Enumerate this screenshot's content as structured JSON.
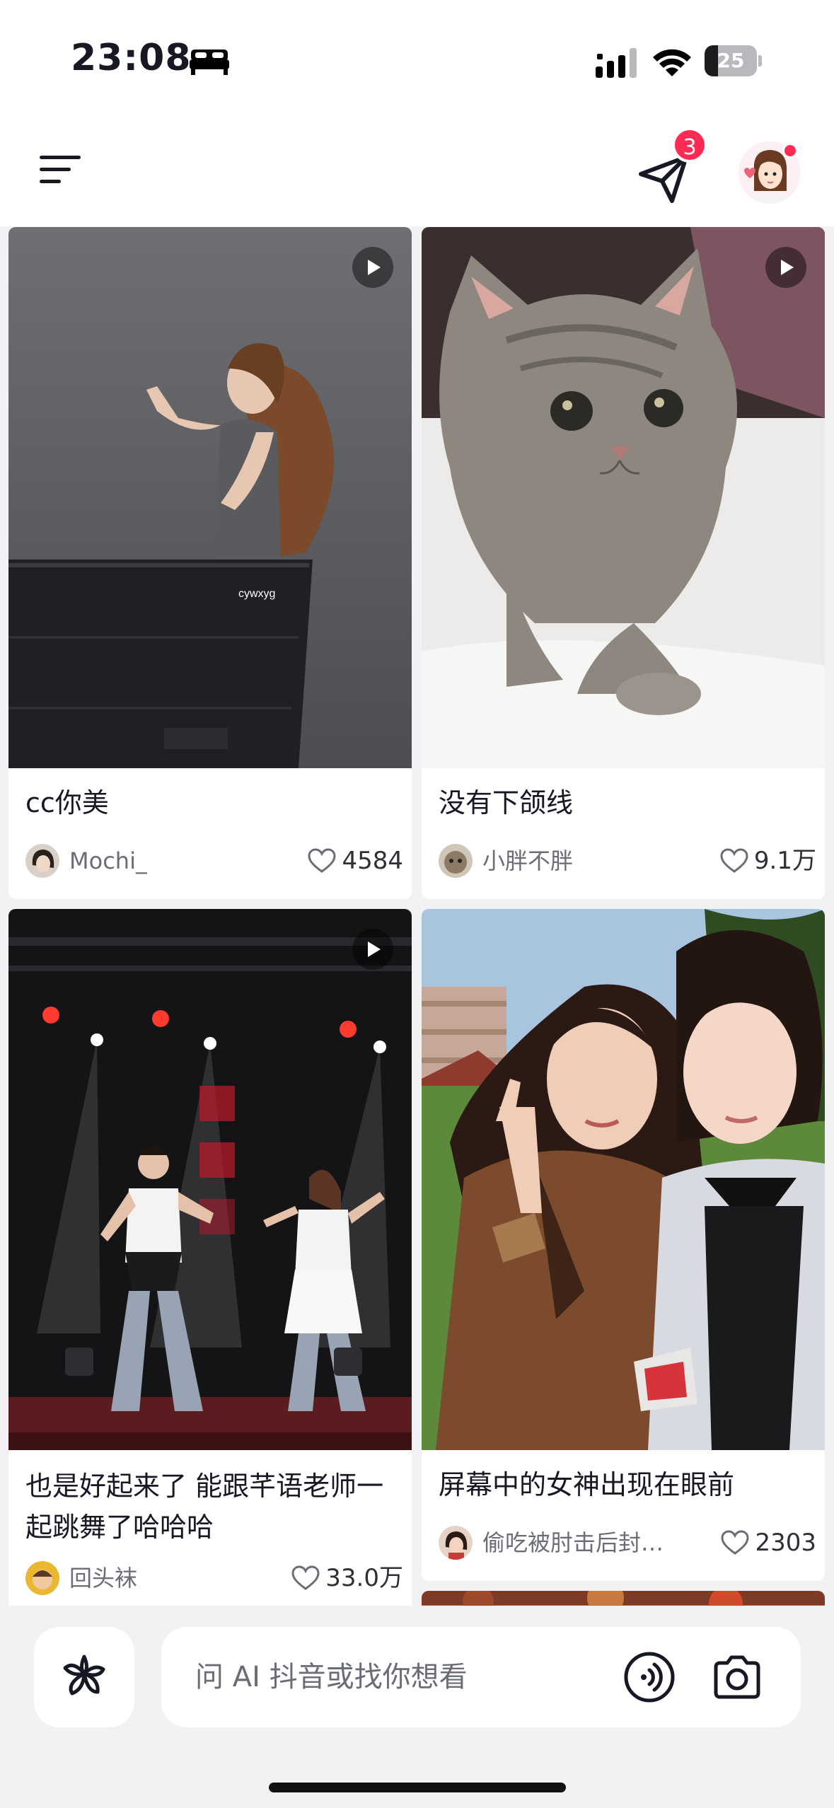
{
  "status_bar": {
    "time": "23:08",
    "battery": "25",
    "battery_level": 0.25,
    "icons": [
      "bed-icon",
      "signal-icon",
      "wifi-icon",
      "battery-icon"
    ]
  },
  "header": {
    "menu_icon": "menu-icon",
    "messages_badge": "3",
    "messages_icon": "paper-plane-icon"
  },
  "feed": {
    "cards": [
      {
        "title": "cc你美",
        "author": "Mochi_",
        "likes": "4584",
        "is_video": true,
        "watermark": "cywxyg"
      },
      {
        "title": "没有下颌线",
        "author": "小胖不胖",
        "likes": "9.1万",
        "is_video": true
      },
      {
        "title": "也是好起来了 能跟芊语老师一起跳舞了哈哈哈",
        "author": "回头袜",
        "likes": "33.0万",
        "is_video": true
      },
      {
        "title": "屏幕中的女神出现在眼前",
        "author": "偷吃被肘击后封…",
        "likes": "2303",
        "is_video": false
      }
    ]
  },
  "bottom_bar": {
    "ai_placeholder": "问 AI 抖音或找你想看",
    "icons": [
      "sparkle-icon",
      "voice-icon",
      "camera-icon"
    ]
  },
  "colors": {
    "accent": "#fe2c55",
    "text": "#161823",
    "secondary_text": "#6b6d75",
    "background": "#f2f2f4"
  }
}
